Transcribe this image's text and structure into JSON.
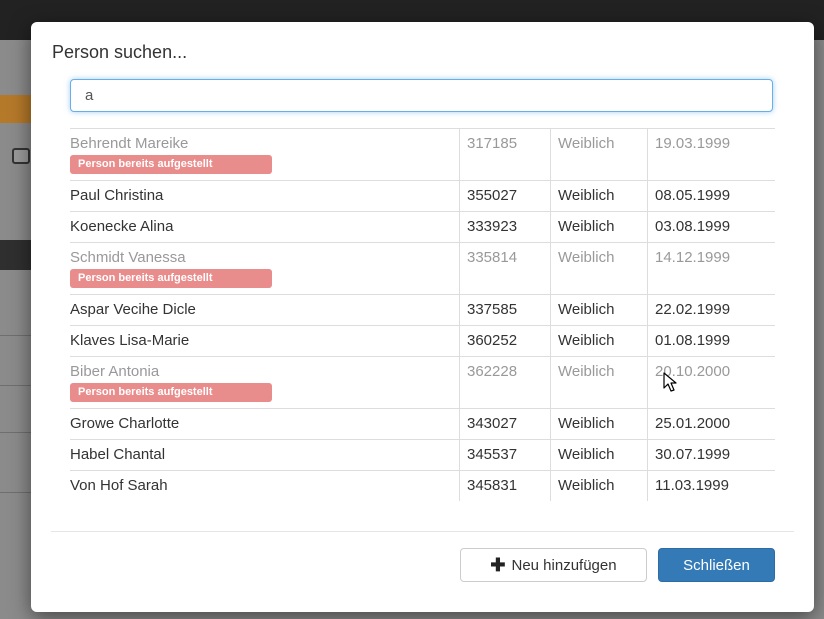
{
  "dialog": {
    "title": "Person suchen...",
    "search": {
      "value": "a",
      "placeholder": ""
    },
    "badge_text": "Person bereits aufgestellt",
    "rows": [
      {
        "name": "Behrendt Mareike",
        "id": "317185",
        "gender": "Weiblich",
        "birthdate": "19.03.1999",
        "already_assigned": true
      },
      {
        "name": "Paul Christina",
        "id": "355027",
        "gender": "Weiblich",
        "birthdate": "08.05.1999",
        "already_assigned": false
      },
      {
        "name": "Koenecke Alina",
        "id": "333923",
        "gender": "Weiblich",
        "birthdate": "03.08.1999",
        "already_assigned": false
      },
      {
        "name": "Schmidt Vanessa",
        "id": "335814",
        "gender": "Weiblich",
        "birthdate": "14.12.1999",
        "already_assigned": true
      },
      {
        "name": "Aspar Vecihe Dicle",
        "id": "337585",
        "gender": "Weiblich",
        "birthdate": "22.02.1999",
        "already_assigned": false
      },
      {
        "name": "Klaves Lisa-Marie",
        "id": "360252",
        "gender": "Weiblich",
        "birthdate": "01.08.1999",
        "already_assigned": false
      },
      {
        "name": "Biber Antonia",
        "id": "362228",
        "gender": "Weiblich",
        "birthdate": "20.10.2000",
        "already_assigned": true
      },
      {
        "name": "Growe Charlotte",
        "id": "343027",
        "gender": "Weiblich",
        "birthdate": "25.01.2000",
        "already_assigned": false
      },
      {
        "name": "Habel Chantal",
        "id": "345537",
        "gender": "Weiblich",
        "birthdate": "30.07.1999",
        "already_assigned": false
      },
      {
        "name": "Von Hof Sarah",
        "id": "345831",
        "gender": "Weiblich",
        "birthdate": "11.03.1999",
        "already_assigned": false
      }
    ],
    "buttons": {
      "add_new": {
        "label": "Neu hinzufügen",
        "icon": "plus-icon"
      },
      "close": {
        "label": "Schließen"
      }
    }
  },
  "colors": {
    "accent": "#337ab7",
    "badge": "#e98c8c",
    "focus_border": "#66afe9"
  }
}
